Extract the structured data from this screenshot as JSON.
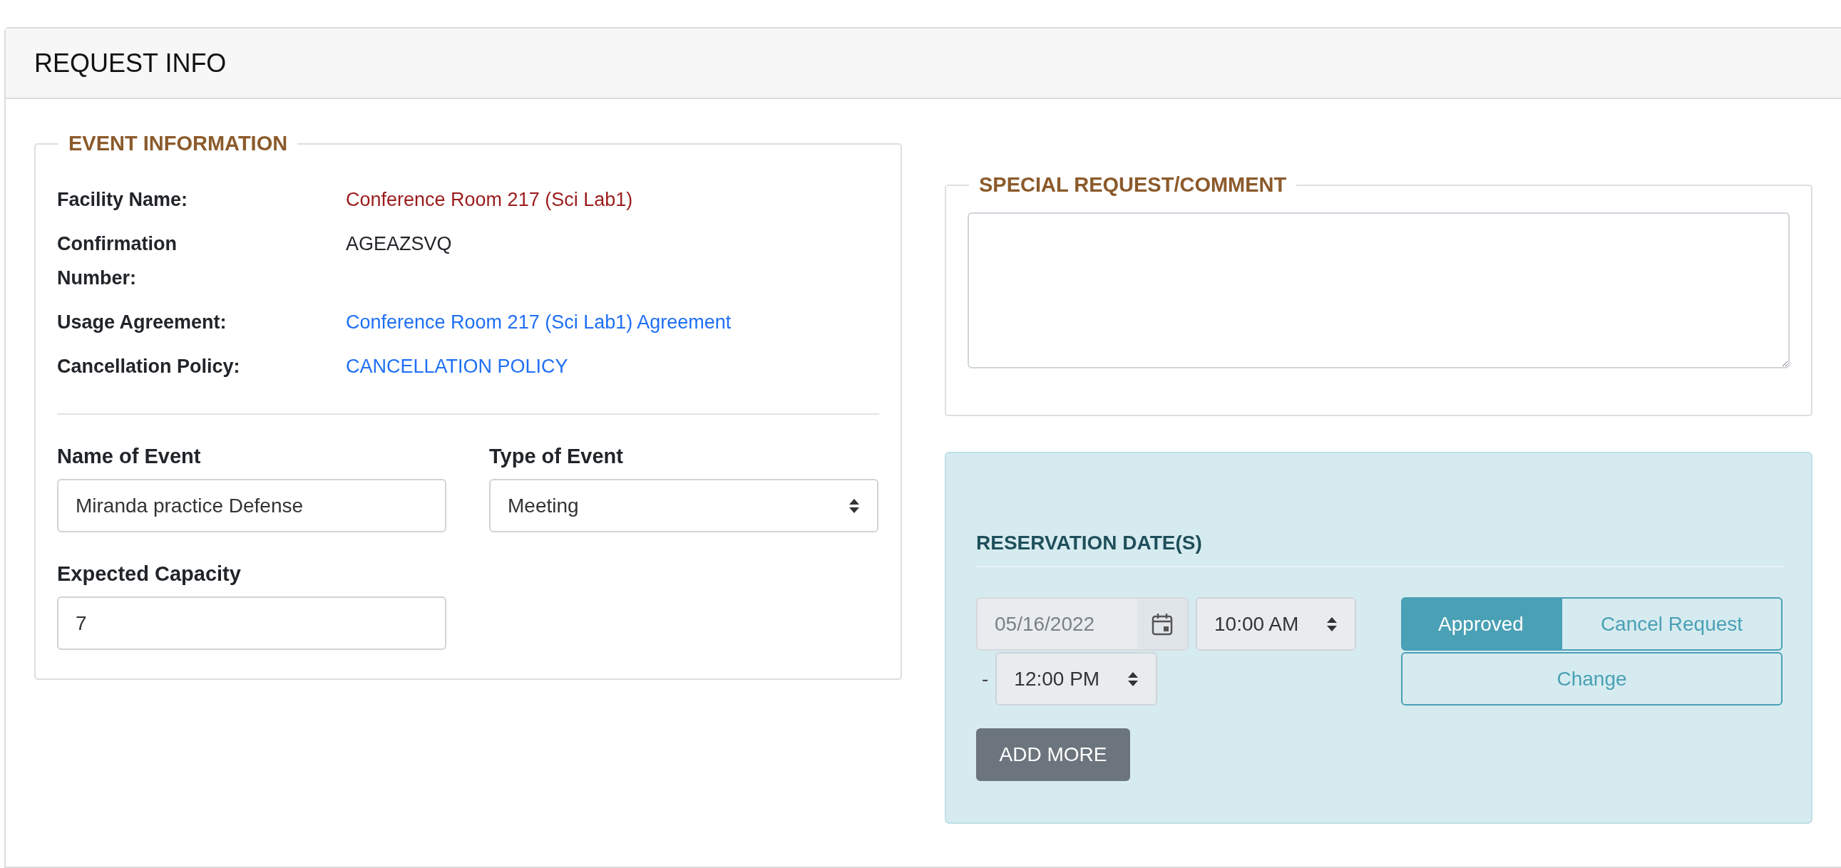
{
  "card": {
    "title": "REQUEST INFO"
  },
  "event_information": {
    "legend": "EVENT INFORMATION",
    "details": [
      {
        "label": "Facility Name:",
        "value": "Conference Room 217 (Sci Lab1)",
        "kind": "highlight"
      },
      {
        "label": "Confirmation Number:",
        "value": "AGEAZSVQ",
        "kind": "plain"
      },
      {
        "label": "Usage Agreement:",
        "value": "Conference Room 217 (Sci Lab1) Agreement",
        "kind": "link"
      },
      {
        "label": "Cancellation Policy:",
        "value": "CANCELLATION POLICY",
        "kind": "link"
      }
    ],
    "name_of_event": {
      "label": "Name of Event",
      "value": "Miranda practice Defense"
    },
    "type_of_event": {
      "label": "Type of Event",
      "value": "Meeting"
    },
    "expected_capacity": {
      "label": "Expected Capacity",
      "value": "7"
    }
  },
  "special_request": {
    "legend": "SPECIAL REQUEST/COMMENT"
  },
  "reservation": {
    "heading": "RESERVATION DATE(S)",
    "date": {
      "value": "05/16/2022",
      "disabled": true
    },
    "start_time": "10:00 AM",
    "separator": "-",
    "end_time": "12:00 PM",
    "statuses": [
      {
        "label": "Approved",
        "selected": true
      },
      {
        "label": "Cancel Request",
        "selected": false
      }
    ],
    "change_button": "Change",
    "add_more_button": "ADD MORE"
  }
}
